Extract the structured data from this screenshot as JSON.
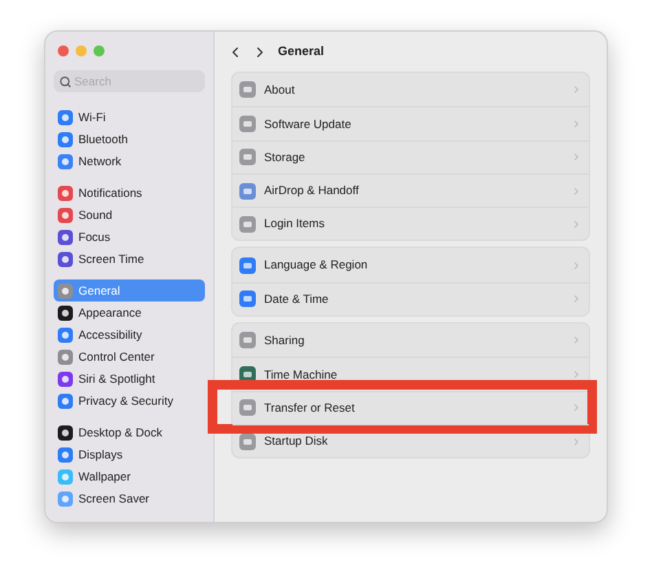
{
  "sidebar": {
    "search": {
      "placeholder": "Search"
    },
    "sections": [
      {
        "items": [
          {
            "label": "Wi-Fi",
            "color": "#2f7cf6",
            "selected": false
          },
          {
            "label": "Bluetooth",
            "color": "#2f7cf6",
            "selected": false
          },
          {
            "label": "Network",
            "color": "#3b82f6",
            "selected": false
          }
        ]
      },
      {
        "items": [
          {
            "label": "Notifications",
            "color": "#e5484d",
            "selected": false
          },
          {
            "label": "Sound",
            "color": "#e5484d",
            "selected": false
          },
          {
            "label": "Focus",
            "color": "#5b4fd6",
            "selected": false
          },
          {
            "label": "Screen Time",
            "color": "#5b4fd6",
            "selected": false
          }
        ]
      },
      {
        "items": [
          {
            "label": "General",
            "color": "#8e8e93",
            "selected": true
          },
          {
            "label": "Appearance",
            "color": "#1c1c1e",
            "selected": false
          },
          {
            "label": "Accessibility",
            "color": "#2f7cf6",
            "selected": false
          },
          {
            "label": "Control Center",
            "color": "#8e8e93",
            "selected": false
          },
          {
            "label": "Siri & Spotlight",
            "color": "#7c3aed",
            "selected": false
          },
          {
            "label": "Privacy & Security",
            "color": "#2f7cf6",
            "selected": false
          }
        ]
      },
      {
        "items": [
          {
            "label": "Desktop & Dock",
            "color": "#1c1c1e",
            "selected": false
          },
          {
            "label": "Displays",
            "color": "#2f7cf6",
            "selected": false
          },
          {
            "label": "Wallpaper",
            "color": "#38bdf8",
            "selected": false
          },
          {
            "label": "Screen Saver",
            "color": "#60a5fa",
            "selected": false
          }
        ]
      }
    ]
  },
  "header": {
    "title": "General"
  },
  "groups": [
    {
      "rows": [
        {
          "label": "About",
          "color": "#9a9a9e",
          "highlighted": false
        },
        {
          "label": "Software Update",
          "color": "#9a9a9e",
          "highlighted": false
        },
        {
          "label": "Storage",
          "color": "#9a9a9e",
          "highlighted": false
        },
        {
          "label": "AirDrop & Handoff",
          "color": "#6b8fd6",
          "highlighted": false
        },
        {
          "label": "Login Items",
          "color": "#9a9a9e",
          "highlighted": false
        }
      ]
    },
    {
      "rows": [
        {
          "label": "Language & Region",
          "color": "#2f7cf6",
          "highlighted": false
        },
        {
          "label": "Date & Time",
          "color": "#2f7cf6",
          "highlighted": false
        }
      ]
    },
    {
      "rows": [
        {
          "label": "Sharing",
          "color": "#9a9a9e",
          "highlighted": false
        },
        {
          "label": "Time Machine",
          "color": "#2f6f5a",
          "highlighted": false
        },
        {
          "label": "Transfer or Reset",
          "color": "#9a9a9e",
          "highlighted": true
        },
        {
          "label": "Startup Disk",
          "color": "#9a9a9e",
          "highlighted": false
        }
      ]
    }
  ]
}
